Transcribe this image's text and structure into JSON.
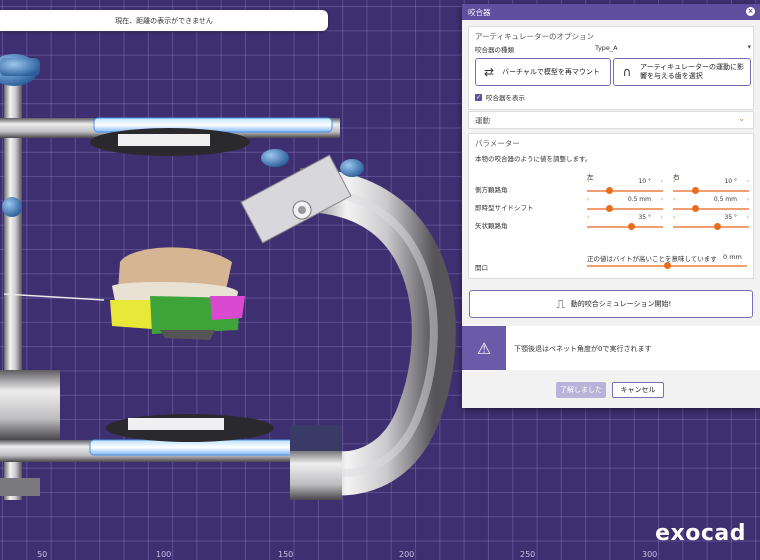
{
  "status_bar": {
    "text": "現在、距離の表示ができません"
  },
  "ruler": {
    "ticks": [
      "50",
      "100",
      "150",
      "200",
      "250",
      "300"
    ]
  },
  "brand": {
    "logo_text": "exocad"
  },
  "dialog": {
    "title": "咬合器",
    "articulator_options": {
      "title": "アーティキュレーターのオプション",
      "type_label": "咬合器の種類",
      "type_value": "Type_A",
      "remount_button": "バーチャルで模型を再マウント",
      "select_teeth_button": "アーティキュレーターの運動に影響を与える歯を選択",
      "show_articulator_label": "咬合器を表示",
      "show_articulator_checked": true
    },
    "movement": {
      "title": "運動"
    },
    "parameters": {
      "title": "パラメーター",
      "description": "本物の咬合器のように値を調整します。",
      "left_header": "左",
      "right_header": "右",
      "rows": [
        {
          "label": "側方顆路角",
          "left_value": "10 °",
          "right_value": "10 °",
          "left_fraction": 0.28,
          "right_fraction": 0.28
        },
        {
          "label": "即時型サイドシフト",
          "left_value": "0.5 mm",
          "right_value": "0.5 mm",
          "left_fraction": 0.28,
          "right_fraction": 0.28
        },
        {
          "label": "矢状顆路角",
          "left_value": "35 °",
          "right_value": "35 °",
          "left_fraction": 0.6,
          "right_fraction": 0.6
        }
      ],
      "opening": {
        "label": "開口",
        "note": "正の値はバイトが高いことを意味しています",
        "value": "0 mm",
        "fraction": 0.5
      }
    },
    "simulation_button": "動的咬合シミュレーション開始!",
    "warning": {
      "text": "下顎後退はベネット角度が0で実行されます"
    },
    "ok_button": "了解しました",
    "cancel_button": "キャンセル"
  }
}
